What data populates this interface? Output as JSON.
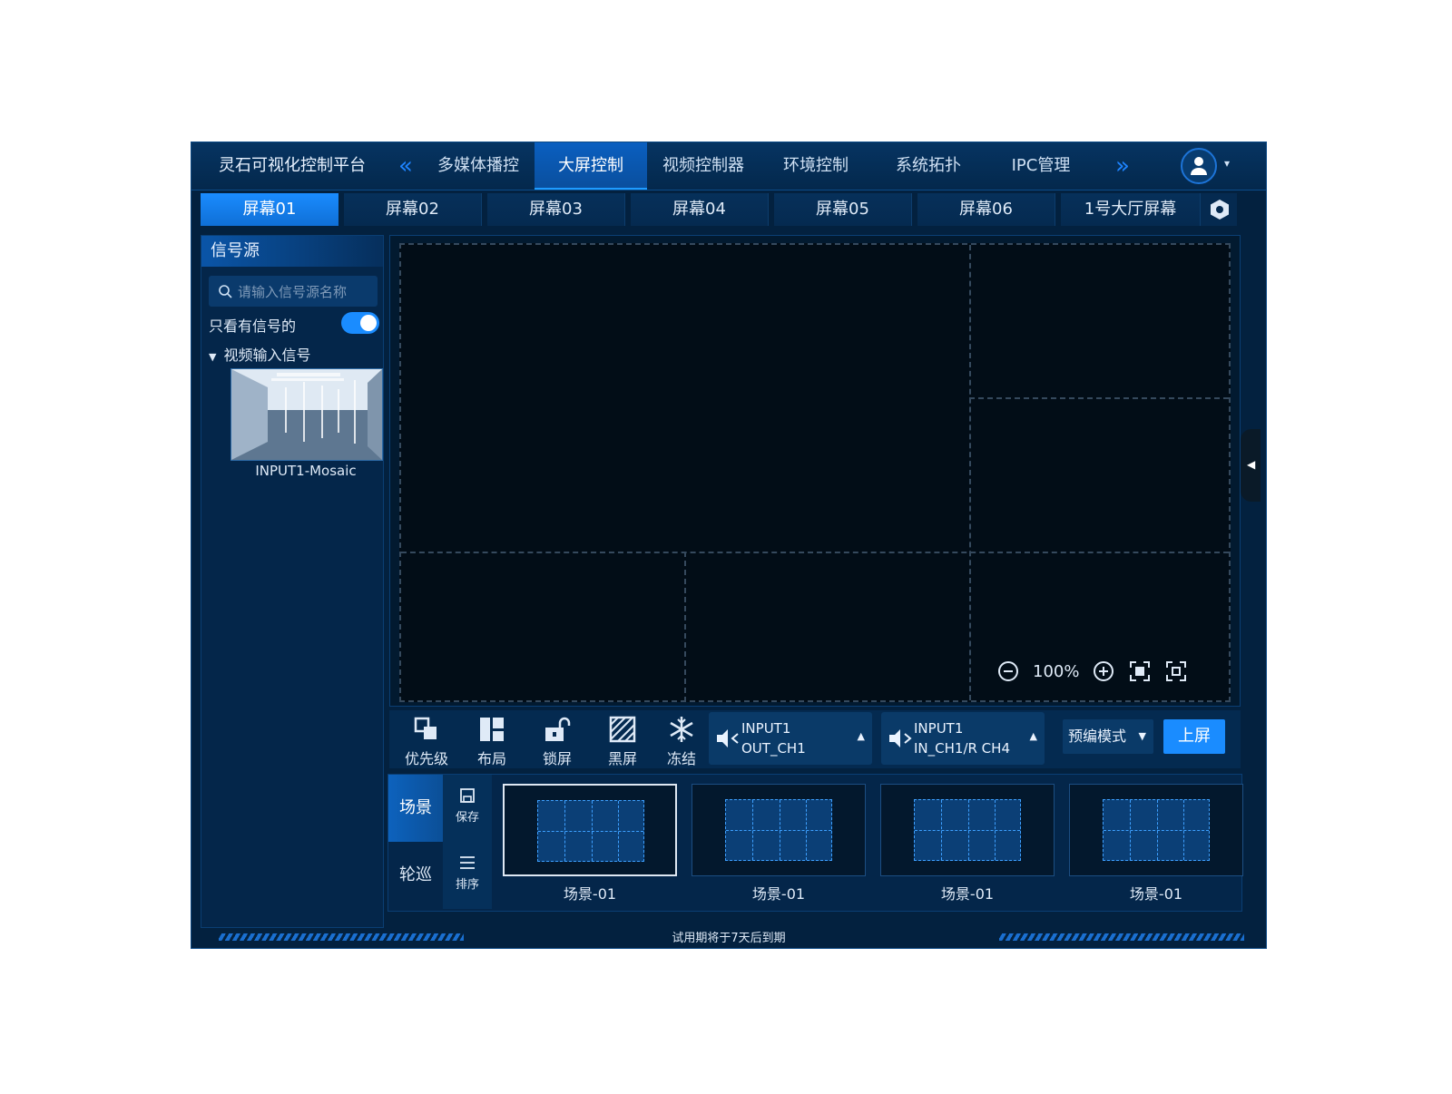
{
  "app": {
    "title": "灵石可视化控制平台"
  },
  "nav": {
    "prev_arrow": "«",
    "next_arrow": "»",
    "tabs": [
      {
        "label": "多媒体播控"
      },
      {
        "label": "大屏控制",
        "active": true
      },
      {
        "label": "视频控制器"
      },
      {
        "label": "环境控制"
      },
      {
        "label": "系统拓扑"
      },
      {
        "label": "IPC管理"
      }
    ],
    "user_icon": "user-icon",
    "caret": "▾"
  },
  "screen_tabs": [
    {
      "label": "屏幕01",
      "active": true
    },
    {
      "label": "屏幕02"
    },
    {
      "label": "屏幕03"
    },
    {
      "label": "屏幕04"
    },
    {
      "label": "屏幕05"
    },
    {
      "label": "屏幕06"
    },
    {
      "label": "1号大厅屏幕"
    }
  ],
  "sidebar": {
    "title": "信号源",
    "search_placeholder": "请输入信号源名称",
    "only_signal_label": "只看有信号的",
    "only_signal_on": true,
    "tree_label": "视频输入信号",
    "source_name": "INPUT1-Mosaic"
  },
  "canvas": {
    "zoom_level": "100%"
  },
  "toolbar": {
    "tools": [
      {
        "label": "优先级",
        "icon": "priority-icon"
      },
      {
        "label": "布局",
        "icon": "layout-icon"
      },
      {
        "label": "锁屏",
        "icon": "unlock-icon"
      },
      {
        "label": "黑屏",
        "icon": "blackscreen-icon"
      },
      {
        "label": "冻结",
        "icon": "snowflake-icon"
      }
    ],
    "audio1": {
      "line1": "INPUT1",
      "line2": "OUT_CH1"
    },
    "audio2": {
      "line1": "INPUT1",
      "line2": "IN_CH1/R CH4"
    },
    "mode": "预编模式",
    "publish": "上屏"
  },
  "scenes": {
    "tab_scene": "场景",
    "tab_tour": "轮巡",
    "save_label": "保存",
    "sort_label": "排序",
    "items": [
      {
        "label": "场景-01",
        "selected": true
      },
      {
        "label": "场景-01"
      },
      {
        "label": "场景-01"
      },
      {
        "label": "场景-01"
      }
    ]
  },
  "footer": {
    "message": "试用期将于7天后到期"
  },
  "colors": {
    "accent": "#1a8cff",
    "background": "#03213f"
  }
}
